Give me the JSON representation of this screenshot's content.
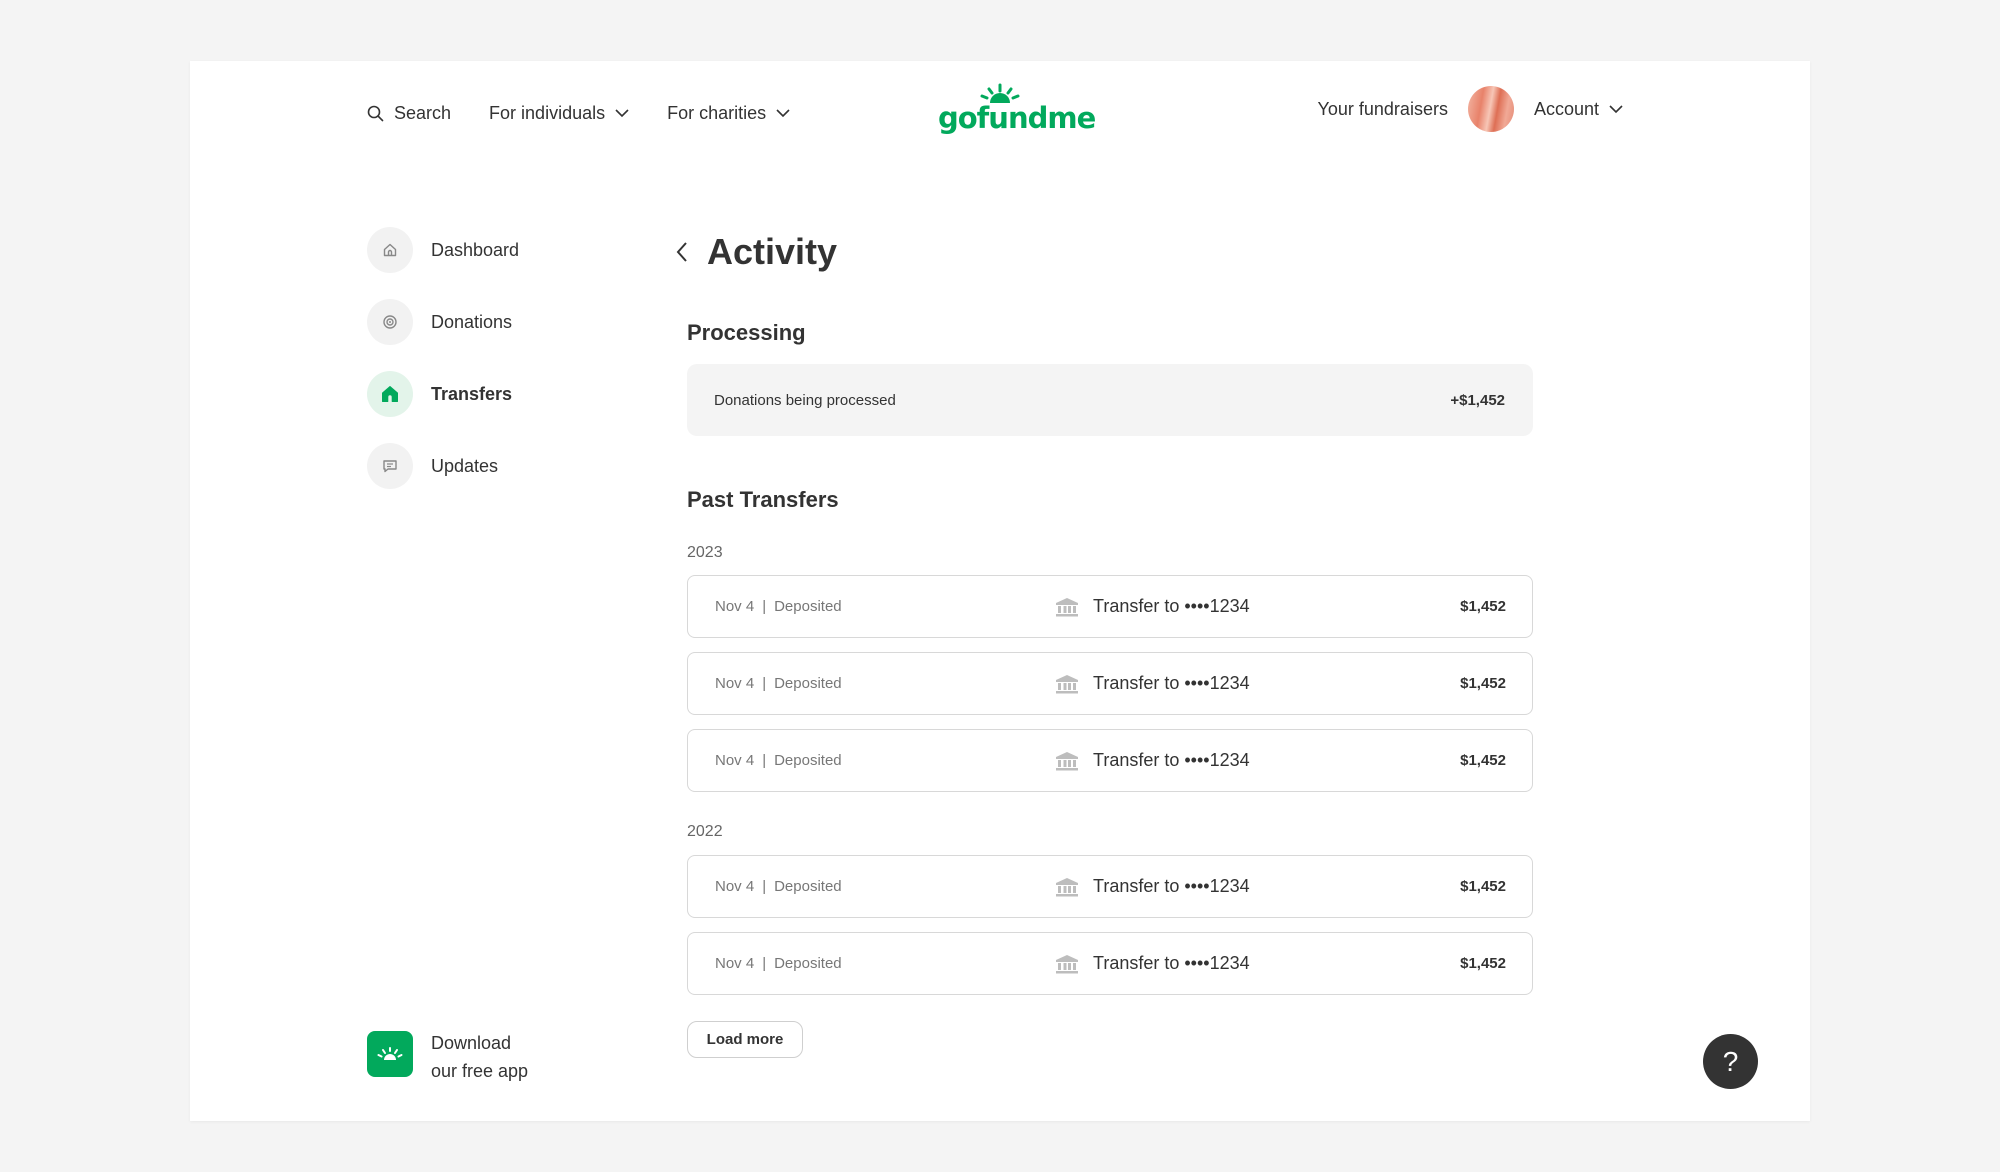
{
  "header": {
    "search_label": "Search",
    "for_individuals": "For individuals",
    "for_charities": "For charities",
    "logo_text": "gofundme",
    "your_fundraisers": "Your fundraisers",
    "account": "Account"
  },
  "sidebar": {
    "items": [
      {
        "label": "Dashboard",
        "icon": "home-outline-icon"
      },
      {
        "label": "Donations",
        "icon": "donations-icon"
      },
      {
        "label": "Transfers",
        "icon": "home-filled-icon",
        "active": true
      },
      {
        "label": "Updates",
        "icon": "chat-icon"
      }
    ],
    "download_line1": "Download",
    "download_line2": "our free app"
  },
  "main": {
    "title": "Activity",
    "processing_heading": "Processing",
    "processing_label": "Donations being processed",
    "processing_amount": "+$1,452",
    "past_heading": "Past Transfers",
    "groups": [
      {
        "year": "2023",
        "rows": [
          {
            "date": "Nov 4",
            "sep": "|",
            "status": "Deposited",
            "transfer": "Transfer to ••••1234",
            "amount": "$1,452"
          },
          {
            "date": "Nov 4",
            "sep": "|",
            "status": "Deposited",
            "transfer": "Transfer to ••••1234",
            "amount": "$1,452"
          },
          {
            "date": "Nov 4",
            "sep": "|",
            "status": "Deposited",
            "transfer": "Transfer to ••••1234",
            "amount": "$1,452"
          }
        ]
      },
      {
        "year": "2022",
        "rows": [
          {
            "date": "Nov 4",
            "sep": "|",
            "status": "Deposited",
            "transfer": "Transfer to ••••1234",
            "amount": "$1,452"
          },
          {
            "date": "Nov 4",
            "sep": "|",
            "status": "Deposited",
            "transfer": "Transfer to ••••1234",
            "amount": "$1,452"
          }
        ]
      }
    ],
    "load_more": "Load more"
  },
  "help_label": "?",
  "colors": {
    "brand": "#02a95c",
    "background": "#f4f4f4",
    "text": "#333333"
  }
}
